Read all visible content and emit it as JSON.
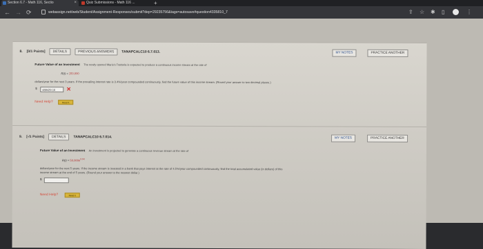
{
  "browser": {
    "tabs": [
      {
        "label": "Section 6.7 - Math 116, Sectio",
        "close": "×"
      },
      {
        "label": "Quiz Submissions - Math 116 ..."
      }
    ],
    "new_tab": "+",
    "url": "webassign.net/web/Student/Assignment-Responses/submit?dep=29235756&tags=autosave#question4335810_7"
  },
  "questions": [
    {
      "number": "8.",
      "points": "[0/1 Points]",
      "details_label": "DETAILS",
      "previous_answers_label": "PREVIOUS ANSWERS",
      "code": "TANAPCALC10 6.7.013.",
      "my_notes_label": "MY NOTES",
      "practice_label": "PRACTICE ANOTHER",
      "title": "Future Value of an Investment",
      "intro": "The newly opened Mario's Trattoria is expected to produce a continuous income stream at the rate of",
      "formula_lhs": "R(t) =",
      "formula_value": "150,000",
      "body": "dollars/year for the next 3 years. If the prevailing interest rate is 3.4%/year compounded continuously, find the future value of this income stream. (Round your answer to two decimal places.)",
      "currency": "$",
      "answer": "489429.16",
      "need_help": "Need Help?",
      "read_it": "Read It"
    },
    {
      "number": "9.",
      "points": "[-/1 Points]",
      "details_label": "DETAILS",
      "code": "TANAPCALC10 6.7.014.",
      "my_notes_label": "MY NOTES",
      "practice_label": "PRACTICE ANOTHER",
      "title": "Future Value of an Investment",
      "intro": "An investment is projected to generate a continuous revenue stream at the rate of",
      "formula_lhs": "R(t) =",
      "formula_value": "50,000e",
      "formula_exp": "0.04t",
      "body_line1": "dollars/year for the next 5 years. If the income stream is invested in a bank that pays interest at the rate of 4.5%/year compounded continuously, find the total accumulated value (in dollars) of this",
      "body_line2": "income stream at the end of 5 years. (Round your answer to the nearest dollar.)",
      "currency": "$",
      "answer": "",
      "need_help": "Need Help?",
      "read_it": "Read It"
    }
  ]
}
